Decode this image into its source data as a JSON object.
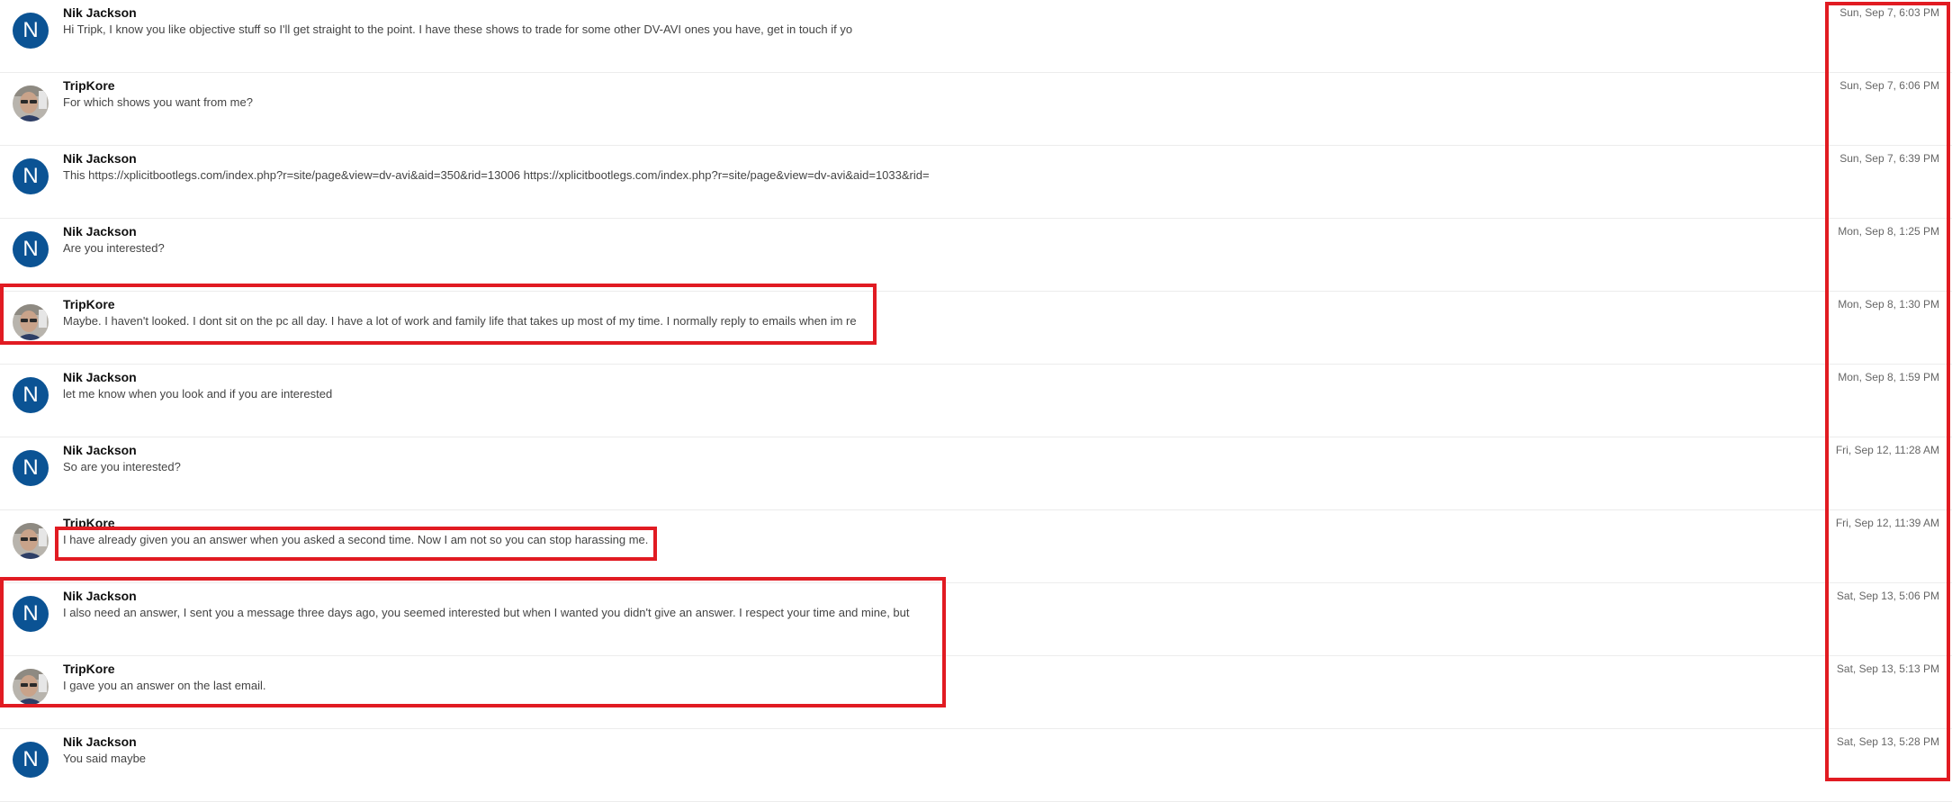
{
  "colors": {
    "avatar_bg": "#0b5394",
    "highlight": "#e11b22"
  },
  "messages": [
    {
      "sender": "Nik Jackson",
      "avatar": "N",
      "snippet": "Hi Tripk, I know you like objective stuff so I'll get straight to the point. I have these shows to trade for some other DV-AVI ones you have, get in touch if yo",
      "date": "Sun, Sep 7, 6:03 PM"
    },
    {
      "sender": "TripKore",
      "avatar": "photo",
      "snippet": "For which shows you want from me?",
      "date": "Sun, Sep 7, 6:06 PM"
    },
    {
      "sender": "Nik Jackson",
      "avatar": "N",
      "snippet": "This https://xplicitbootlegs.com/index.php?r=site/page&view=dv-avi&aid=350&rid=13006 https://xplicitbootlegs.com/index.php?r=site/page&view=dv-avi&aid=1033&rid=",
      "date": "Sun, Sep 7, 6:39 PM"
    },
    {
      "sender": "Nik Jackson",
      "avatar": "N",
      "snippet": "Are you interested?",
      "date": "Mon, Sep 8, 1:25 PM"
    },
    {
      "sender": "TripKore",
      "avatar": "photo",
      "snippet": "Maybe. I haven't looked. I dont sit on the pc all day. I have a lot of work and family life that takes up most of my time. I normally reply to emails when im re",
      "date": "Mon, Sep 8, 1:30 PM"
    },
    {
      "sender": "Nik Jackson",
      "avatar": "N",
      "snippet": "let me know when you look and if you are interested",
      "date": "Mon, Sep 8, 1:59 PM"
    },
    {
      "sender": "Nik Jackson",
      "avatar": "N",
      "snippet": "So are you interested?",
      "date": "Fri, Sep 12, 11:28 AM"
    },
    {
      "sender": "TripKore",
      "avatar": "photo",
      "snippet": "I have already given you an answer when you asked a second time. Now I am not so you can stop harassing me.",
      "date": "Fri, Sep 12, 11:39 AM"
    },
    {
      "sender": "Nik Jackson",
      "avatar": "N",
      "snippet": "I also need an answer, I sent you a message three days ago, you seemed interested but when I wanted you didn't give an answer. I respect your time and mine, but",
      "date": "Sat, Sep 13, 5:06 PM"
    },
    {
      "sender": "TripKore",
      "avatar": "photo",
      "snippet": "I gave you an answer on the last email.",
      "date": "Sat, Sep 13, 5:13 PM"
    },
    {
      "sender": "Nik Jackson",
      "avatar": "N",
      "snippet": "You said maybe",
      "date": "Sat, Sep 13, 5:28 PM"
    }
  ]
}
